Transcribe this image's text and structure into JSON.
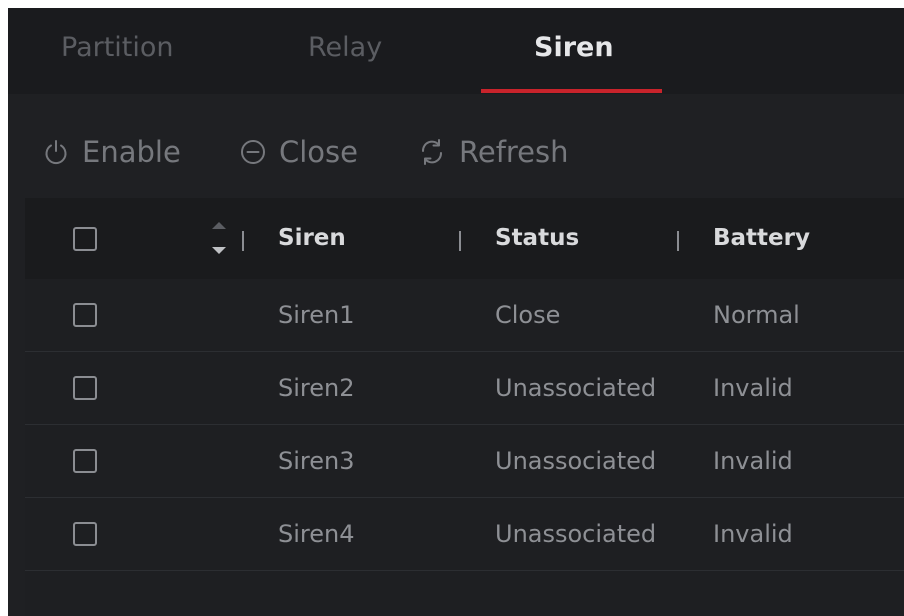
{
  "tabs": [
    {
      "label": "Partition",
      "active": false
    },
    {
      "label": "Relay",
      "active": false
    },
    {
      "label": "Siren",
      "active": true
    }
  ],
  "toolbar": {
    "enable_label": "Enable",
    "close_label": "Close",
    "refresh_label": "Refresh"
  },
  "table": {
    "columns": [
      "Siren",
      "Status",
      "Battery"
    ],
    "rows": [
      {
        "siren": "Siren1",
        "status": "Close",
        "battery": "Normal"
      },
      {
        "siren": "Siren2",
        "status": "Unassociated",
        "battery": "Invalid"
      },
      {
        "siren": "Siren3",
        "status": "Unassociated",
        "battery": "Invalid"
      },
      {
        "siren": "Siren4",
        "status": "Unassociated",
        "battery": "Invalid"
      }
    ]
  },
  "colors": {
    "accent": "#c8232b",
    "background": "#1f2023",
    "active_text": "#e6e7e9",
    "muted_text": "#5b5d62"
  },
  "icons": [
    "power-icon",
    "minus-circle-icon",
    "refresh-icon",
    "sort-icon"
  ]
}
